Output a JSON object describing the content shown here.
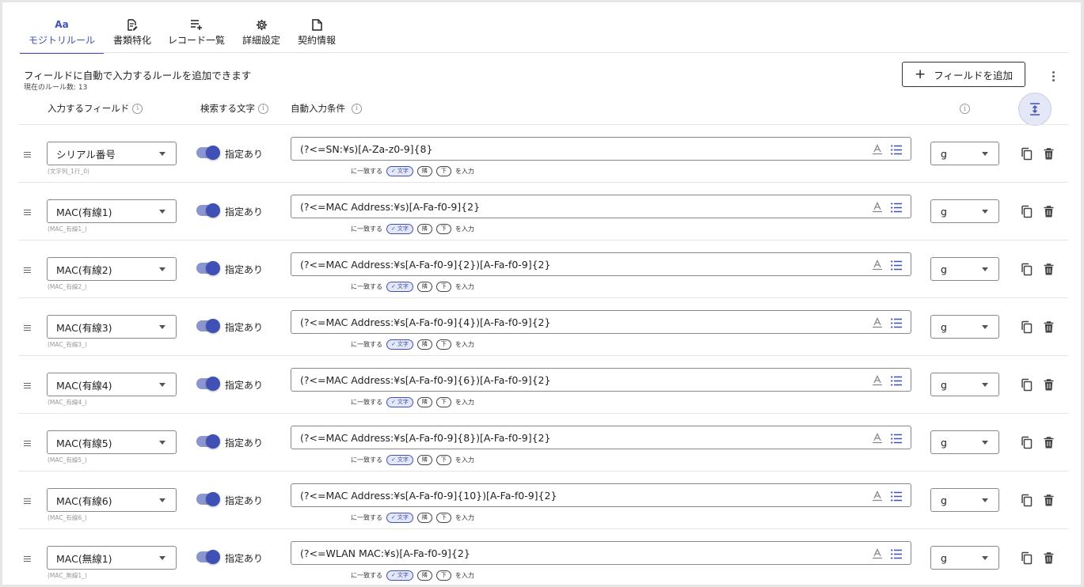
{
  "tabs": [
    {
      "label": "モジトリルール",
      "icon": "font-aa-icon",
      "glyph": "Aa"
    },
    {
      "label": "書類特化",
      "icon": "document-edit-icon"
    },
    {
      "label": "レコード一覧",
      "icon": "list-add-icon"
    },
    {
      "label": "詳細設定",
      "icon": "gear-icon"
    },
    {
      "label": "契約情報",
      "icon": "file-icon"
    }
  ],
  "header": {
    "description": "フィールドに自動で入力するルールを追加できます",
    "rule_count": "現在のルール数: 13",
    "add_button": "フィールドを追加",
    "add_icon": "+"
  },
  "columns": {
    "field": "入力するフィールド",
    "search": "検索する文字",
    "condition": "自動入力条件",
    "info_glyph": "i"
  },
  "option_text": {
    "match": "に一致する",
    "input": "を入力",
    "chip_text": "文字",
    "chip_check": "✓",
    "chip_adjacent": "隣",
    "chip_below": "下"
  },
  "rows": [
    {
      "field": "シリアル番号",
      "hint": "(文字列_1行_0)",
      "toggle_label": "指定あり",
      "toggle_on": true,
      "pattern": "(?<=SN:¥s)[A-Za-z0-9]{8}",
      "flag": "g"
    },
    {
      "field": "MAC(有線1)",
      "hint": "(MAC_有線1_)",
      "toggle_label": "指定あり",
      "toggle_on": true,
      "pattern": "(?<=MAC Address:¥s)[A-Fa-f0-9]{2}",
      "flag": "g"
    },
    {
      "field": "MAC(有線2)",
      "hint": "(MAC_有線2_)",
      "toggle_label": "指定あり",
      "toggle_on": true,
      "pattern": "(?<=MAC Address:¥s[A-Fa-f0-9]{2})[A-Fa-f0-9]{2}",
      "flag": "g"
    },
    {
      "field": "MAC(有線3)",
      "hint": "(MAC_有線3_)",
      "toggle_label": "指定あり",
      "toggle_on": true,
      "pattern": "(?<=MAC Address:¥s[A-Fa-f0-9]{4})[A-Fa-f0-9]{2}",
      "flag": "g"
    },
    {
      "field": "MAC(有線4)",
      "hint": "(MAC_有線4_)",
      "toggle_label": "指定あり",
      "toggle_on": true,
      "pattern": "(?<=MAC Address:¥s[A-Fa-f0-9]{6})[A-Fa-f0-9]{2}",
      "flag": "g"
    },
    {
      "field": "MAC(有線5)",
      "hint": "(MAC_有線5_)",
      "toggle_label": "指定あり",
      "toggle_on": true,
      "pattern": "(?<=MAC Address:¥s[A-Fa-f0-9]{8})[A-Fa-f0-9]{2}",
      "flag": "g"
    },
    {
      "field": "MAC(有線6)",
      "hint": "(MAC_有線6_)",
      "toggle_label": "指定あり",
      "toggle_on": true,
      "pattern": "(?<=MAC Address:¥s[A-Fa-f0-9]{10})[A-Fa-f0-9]{2}",
      "flag": "g"
    },
    {
      "field": "MAC(無線1)",
      "hint": "(MAC_無線1_)",
      "toggle_label": "指定あり",
      "toggle_on": true,
      "pattern": "(?<=WLAN MAC:¥s)[A-Fa-f0-9]{2}",
      "flag": "g"
    }
  ],
  "colors": {
    "accent": "#3f51b5",
    "toggle_track": "#8b95cf",
    "chip_bg": "#e4e7f5"
  }
}
